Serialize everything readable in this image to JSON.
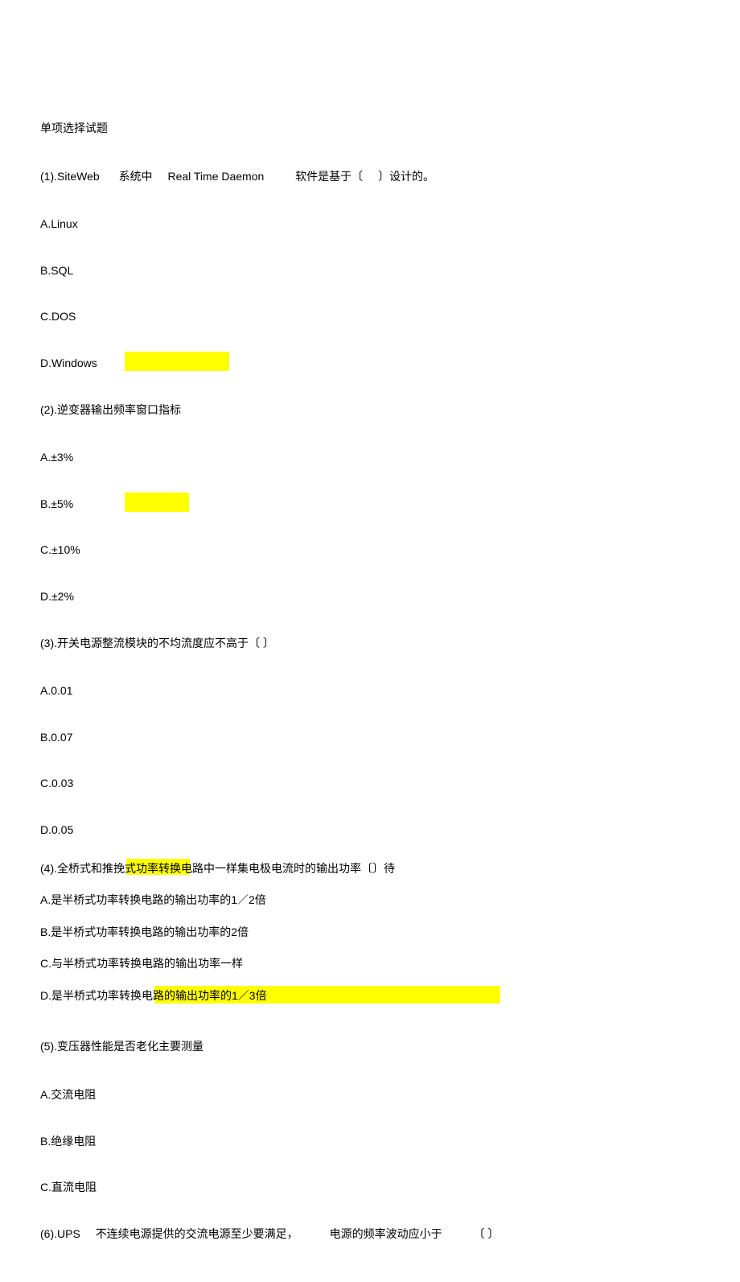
{
  "title": "单项选择试题",
  "q1": {
    "prompt_parts": [
      "(1).SiteWeb",
      "系统中",
      "Real Time Daemon",
      "软件是基于〔",
      "〕设计的。"
    ],
    "a": "A.Linux",
    "b": "B.SQL",
    "c": "C.DOS",
    "d": "D.Windows"
  },
  "q2": {
    "prompt": "(2).逆变器输出频率窗口指标",
    "a": "A.±3%",
    "b": "B.±5%",
    "c": "C.±10%",
    "d": "D.±2%"
  },
  "q3": {
    "prompt": "(3).开关电源整流模块的不均流度应不高于〔        〕",
    "a": "A.0.01",
    "b": "B.0.07",
    "c": "C.0.03",
    "d": "D.0.05"
  },
  "q4": {
    "prompt": "(4).全桥式和推挽式功率转换电路中一样集电极电流时的输出功率〔〕待",
    "a": "A.是半桥式功率转换电路的输出功率的1／2倍",
    "b": "B.是半桥式功率转换电路的输出功率的2倍",
    "c": "C.与半桥式功率转换电路的输出功率一样",
    "d": "D.是半桥式功率转换电路的输出功率的1／3倍"
  },
  "q5": {
    "prompt": "(5).变压器性能是否老化主要测量",
    "a": "A.交流电阻",
    "b": "B.绝缘电阻",
    "c": "C.直流电阻"
  },
  "q6": {
    "prompt_parts": [
      "(6).UPS",
      "不连续电源提供的交流电源至少要满足，",
      "电源的频率波动应小于",
      "〔  〕"
    ]
  }
}
